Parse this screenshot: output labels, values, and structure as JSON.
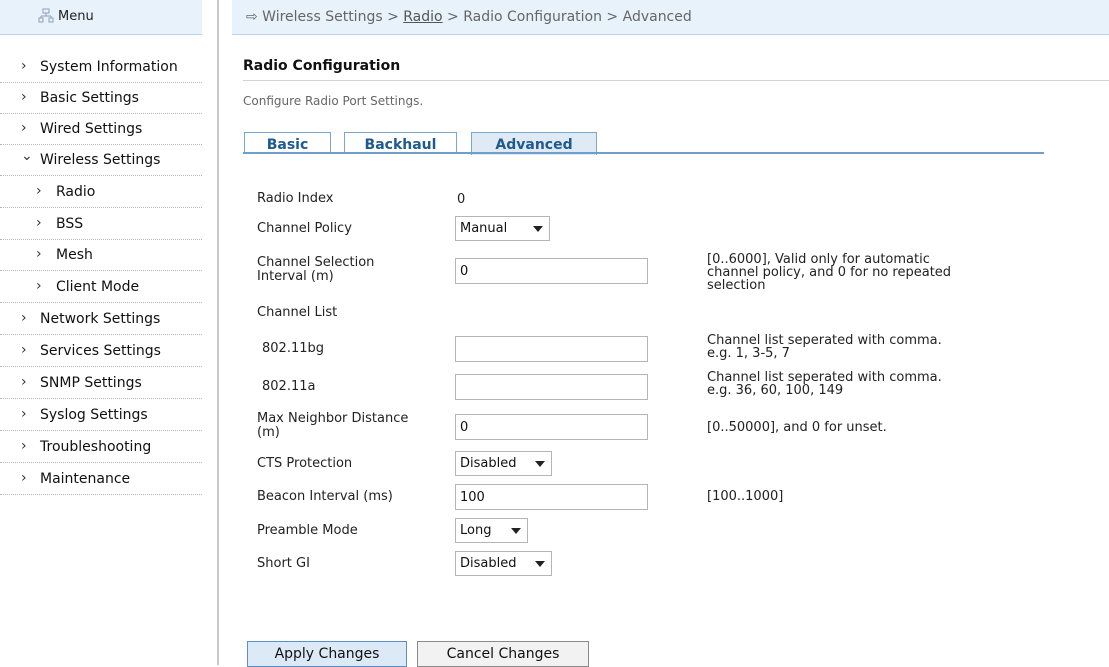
{
  "sidebar": {
    "title": "Menu",
    "items": [
      {
        "label": "System Information",
        "arrow": "›"
      },
      {
        "label": "Basic Settings",
        "arrow": "›"
      },
      {
        "label": "Wired Settings",
        "arrow": "›"
      },
      {
        "label": "Wireless Settings",
        "arrow": "⌄"
      },
      {
        "label": "Radio",
        "arrow": "›"
      },
      {
        "label": "BSS",
        "arrow": "›"
      },
      {
        "label": "Mesh",
        "arrow": "›"
      },
      {
        "label": "Client Mode",
        "arrow": "›"
      },
      {
        "label": "Network Settings",
        "arrow": "›"
      },
      {
        "label": "Services Settings",
        "arrow": "›"
      },
      {
        "label": "SNMP Settings",
        "arrow": "›"
      },
      {
        "label": "Syslog Settings",
        "arrow": "›"
      },
      {
        "label": "Troubleshooting",
        "arrow": "›"
      },
      {
        "label": "Maintenance",
        "arrow": "›"
      }
    ]
  },
  "breadcrumb": {
    "prefix": "⇨ Wireless Settings > ",
    "link": "Radio",
    "suffix": " > Radio Configuration > Advanced"
  },
  "page": {
    "title": "Radio Configuration",
    "description": "Configure Radio Port Settings."
  },
  "tabs": [
    {
      "label": "Basic"
    },
    {
      "label": "Backhaul"
    },
    {
      "label": "Advanced"
    }
  ],
  "form": {
    "radio_index_label": "Radio Index",
    "radio_index_value": "0",
    "channel_policy_label": "Channel Policy",
    "channel_policy_value": "Manual",
    "channel_selection_label_1": "Channel Selection",
    "channel_selection_label_2": "Interval (m)",
    "channel_selection_value": "0",
    "channel_selection_hint_1": "[0..6000], Valid only for automatic",
    "channel_selection_hint_2": "channel policy, and 0 for no repeated",
    "channel_selection_hint_3": "selection",
    "channel_list_label": "Channel List",
    "bg_label": "802.11bg",
    "bg_value": "",
    "bg_hint_1": "Channel list seperated with comma.",
    "bg_hint_2": "e.g. 1, 3-5, 7",
    "a_label": "802.11a",
    "a_value": "",
    "a_hint_1": "Channel list seperated with comma.",
    "a_hint_2": "e.g. 36, 60, 100, 149",
    "max_neighbor_label_1": "Max Neighbor Distance",
    "max_neighbor_label_2": "(m)",
    "max_neighbor_value": "0",
    "max_neighbor_hint": "[0..50000], and 0 for unset.",
    "cts_label": "CTS Protection",
    "cts_value": "Disabled",
    "beacon_label": "Beacon Interval (ms)",
    "beacon_value": "100",
    "beacon_hint": "[100..1000]",
    "preamble_label": "Preamble Mode",
    "preamble_value": "Long",
    "short_gi_label": "Short GI",
    "short_gi_value": "Disabled"
  },
  "buttons": {
    "apply": "Apply Changes",
    "cancel": "Cancel Changes"
  }
}
